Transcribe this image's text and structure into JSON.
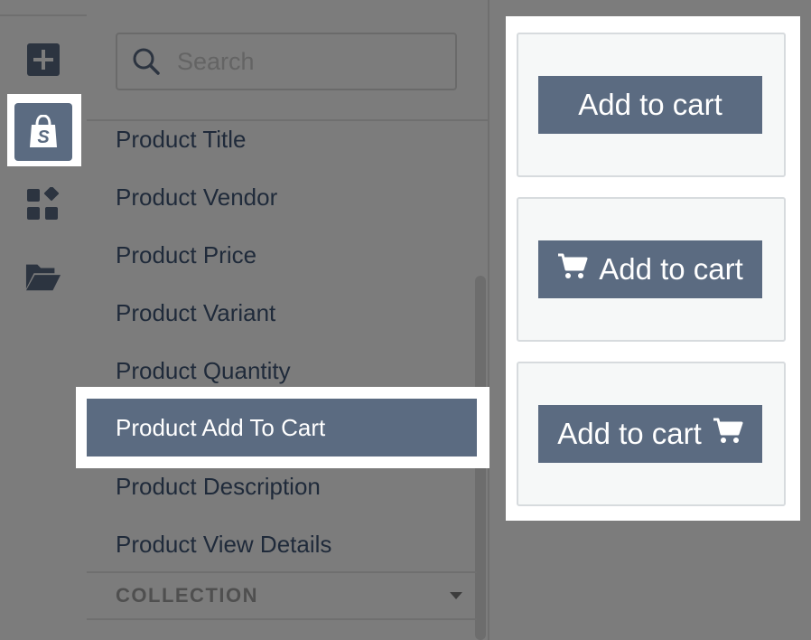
{
  "sidebar": {
    "icons": [
      {
        "name": "add-icon"
      },
      {
        "name": "shopify-bag-icon"
      },
      {
        "name": "apps-icon"
      },
      {
        "name": "folder-open-icon"
      }
    ]
  },
  "search": {
    "placeholder": "Search",
    "value": ""
  },
  "element_list": {
    "items": [
      {
        "label": "Product Title"
      },
      {
        "label": "Product Vendor"
      },
      {
        "label": "Product Price"
      },
      {
        "label": "Product Variant"
      },
      {
        "label": "Product Quantity"
      },
      {
        "label": "Product Add To Cart",
        "selected": true
      },
      {
        "label": "Product Description"
      },
      {
        "label": "Product View Details"
      }
    ]
  },
  "collection_section": {
    "title": "COLLECTION",
    "icon": "chevron-down-icon"
  },
  "preview": {
    "buttons": [
      {
        "label": "Add to cart",
        "icon": "none"
      },
      {
        "label": "Add to cart",
        "icon": "cart-icon-left"
      },
      {
        "label": "Add to cart",
        "icon": "cart-icon-right"
      }
    ]
  },
  "colors": {
    "accent": "#5b6b81",
    "overlay": "#7c7c7c",
    "highlight": "#ffffff",
    "text_dark": "#1f2a3a"
  }
}
